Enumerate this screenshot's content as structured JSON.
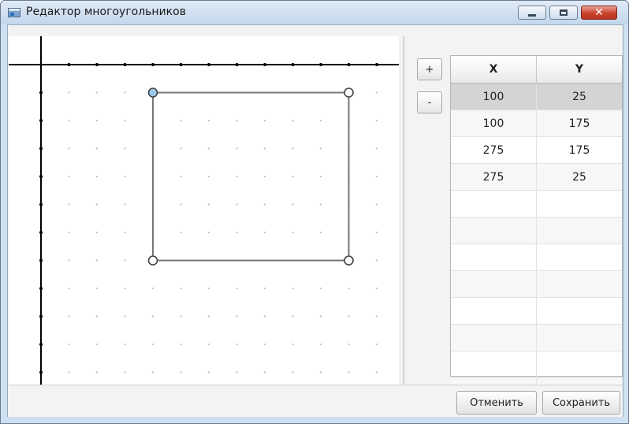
{
  "window": {
    "title": "Редактор многоугольников",
    "min_label": "minimize-icon",
    "max_label": "maximize-icon",
    "close_label": "close-icon"
  },
  "toolbar": {
    "add_label": "+",
    "remove_label": "-"
  },
  "table": {
    "columns": [
      "X",
      "Y"
    ],
    "rows": [
      {
        "x": "100",
        "y": "25"
      },
      {
        "x": "100",
        "y": "175"
      },
      {
        "x": "275",
        "y": "175"
      },
      {
        "x": "275",
        "y": "25"
      }
    ],
    "selected_row": 0
  },
  "polygon": {
    "points": [
      [
        100,
        25
      ],
      [
        100,
        175
      ],
      [
        275,
        175
      ],
      [
        275,
        25
      ]
    ],
    "selected_vertex": 0
  },
  "colors": {
    "polygon_stroke": "#777777",
    "vertex_selected_fill": "#9cc8ec",
    "axis": "#000000",
    "grid_dot": "#c8c8c8"
  },
  "footer": {
    "cancel_label": "Отменить",
    "save_label": "Сохранить"
  }
}
